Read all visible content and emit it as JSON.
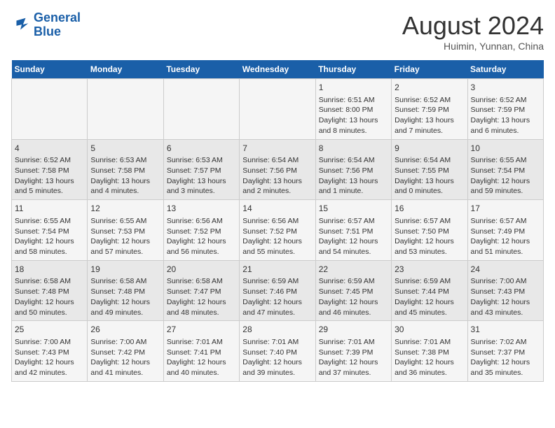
{
  "header": {
    "logo_line1": "General",
    "logo_line2": "Blue",
    "month_title": "August 2024",
    "subtitle": "Huimin, Yunnan, China"
  },
  "days_of_week": [
    "Sunday",
    "Monday",
    "Tuesday",
    "Wednesday",
    "Thursday",
    "Friday",
    "Saturday"
  ],
  "weeks": [
    [
      {
        "day": "",
        "info": ""
      },
      {
        "day": "",
        "info": ""
      },
      {
        "day": "",
        "info": ""
      },
      {
        "day": "",
        "info": ""
      },
      {
        "day": "1",
        "info": "Sunrise: 6:51 AM\nSunset: 8:00 PM\nDaylight: 13 hours\nand 8 minutes."
      },
      {
        "day": "2",
        "info": "Sunrise: 6:52 AM\nSunset: 7:59 PM\nDaylight: 13 hours\nand 7 minutes."
      },
      {
        "day": "3",
        "info": "Sunrise: 6:52 AM\nSunset: 7:59 PM\nDaylight: 13 hours\nand 6 minutes."
      }
    ],
    [
      {
        "day": "4",
        "info": "Sunrise: 6:52 AM\nSunset: 7:58 PM\nDaylight: 13 hours\nand 5 minutes."
      },
      {
        "day": "5",
        "info": "Sunrise: 6:53 AM\nSunset: 7:58 PM\nDaylight: 13 hours\nand 4 minutes."
      },
      {
        "day": "6",
        "info": "Sunrise: 6:53 AM\nSunset: 7:57 PM\nDaylight: 13 hours\nand 3 minutes."
      },
      {
        "day": "7",
        "info": "Sunrise: 6:54 AM\nSunset: 7:56 PM\nDaylight: 13 hours\nand 2 minutes."
      },
      {
        "day": "8",
        "info": "Sunrise: 6:54 AM\nSunset: 7:56 PM\nDaylight: 13 hours\nand 1 minute."
      },
      {
        "day": "9",
        "info": "Sunrise: 6:54 AM\nSunset: 7:55 PM\nDaylight: 13 hours\nand 0 minutes."
      },
      {
        "day": "10",
        "info": "Sunrise: 6:55 AM\nSunset: 7:54 PM\nDaylight: 12 hours\nand 59 minutes."
      }
    ],
    [
      {
        "day": "11",
        "info": "Sunrise: 6:55 AM\nSunset: 7:54 PM\nDaylight: 12 hours\nand 58 minutes."
      },
      {
        "day": "12",
        "info": "Sunrise: 6:55 AM\nSunset: 7:53 PM\nDaylight: 12 hours\nand 57 minutes."
      },
      {
        "day": "13",
        "info": "Sunrise: 6:56 AM\nSunset: 7:52 PM\nDaylight: 12 hours\nand 56 minutes."
      },
      {
        "day": "14",
        "info": "Sunrise: 6:56 AM\nSunset: 7:52 PM\nDaylight: 12 hours\nand 55 minutes."
      },
      {
        "day": "15",
        "info": "Sunrise: 6:57 AM\nSunset: 7:51 PM\nDaylight: 12 hours\nand 54 minutes."
      },
      {
        "day": "16",
        "info": "Sunrise: 6:57 AM\nSunset: 7:50 PM\nDaylight: 12 hours\nand 53 minutes."
      },
      {
        "day": "17",
        "info": "Sunrise: 6:57 AM\nSunset: 7:49 PM\nDaylight: 12 hours\nand 51 minutes."
      }
    ],
    [
      {
        "day": "18",
        "info": "Sunrise: 6:58 AM\nSunset: 7:48 PM\nDaylight: 12 hours\nand 50 minutes."
      },
      {
        "day": "19",
        "info": "Sunrise: 6:58 AM\nSunset: 7:48 PM\nDaylight: 12 hours\nand 49 minutes."
      },
      {
        "day": "20",
        "info": "Sunrise: 6:58 AM\nSunset: 7:47 PM\nDaylight: 12 hours\nand 48 minutes."
      },
      {
        "day": "21",
        "info": "Sunrise: 6:59 AM\nSunset: 7:46 PM\nDaylight: 12 hours\nand 47 minutes."
      },
      {
        "day": "22",
        "info": "Sunrise: 6:59 AM\nSunset: 7:45 PM\nDaylight: 12 hours\nand 46 minutes."
      },
      {
        "day": "23",
        "info": "Sunrise: 6:59 AM\nSunset: 7:44 PM\nDaylight: 12 hours\nand 45 minutes."
      },
      {
        "day": "24",
        "info": "Sunrise: 7:00 AM\nSunset: 7:43 PM\nDaylight: 12 hours\nand 43 minutes."
      }
    ],
    [
      {
        "day": "25",
        "info": "Sunrise: 7:00 AM\nSunset: 7:43 PM\nDaylight: 12 hours\nand 42 minutes."
      },
      {
        "day": "26",
        "info": "Sunrise: 7:00 AM\nSunset: 7:42 PM\nDaylight: 12 hours\nand 41 minutes."
      },
      {
        "day": "27",
        "info": "Sunrise: 7:01 AM\nSunset: 7:41 PM\nDaylight: 12 hours\nand 40 minutes."
      },
      {
        "day": "28",
        "info": "Sunrise: 7:01 AM\nSunset: 7:40 PM\nDaylight: 12 hours\nand 39 minutes."
      },
      {
        "day": "29",
        "info": "Sunrise: 7:01 AM\nSunset: 7:39 PM\nDaylight: 12 hours\nand 37 minutes."
      },
      {
        "day": "30",
        "info": "Sunrise: 7:01 AM\nSunset: 7:38 PM\nDaylight: 12 hours\nand 36 minutes."
      },
      {
        "day": "31",
        "info": "Sunrise: 7:02 AM\nSunset: 7:37 PM\nDaylight: 12 hours\nand 35 minutes."
      }
    ]
  ]
}
